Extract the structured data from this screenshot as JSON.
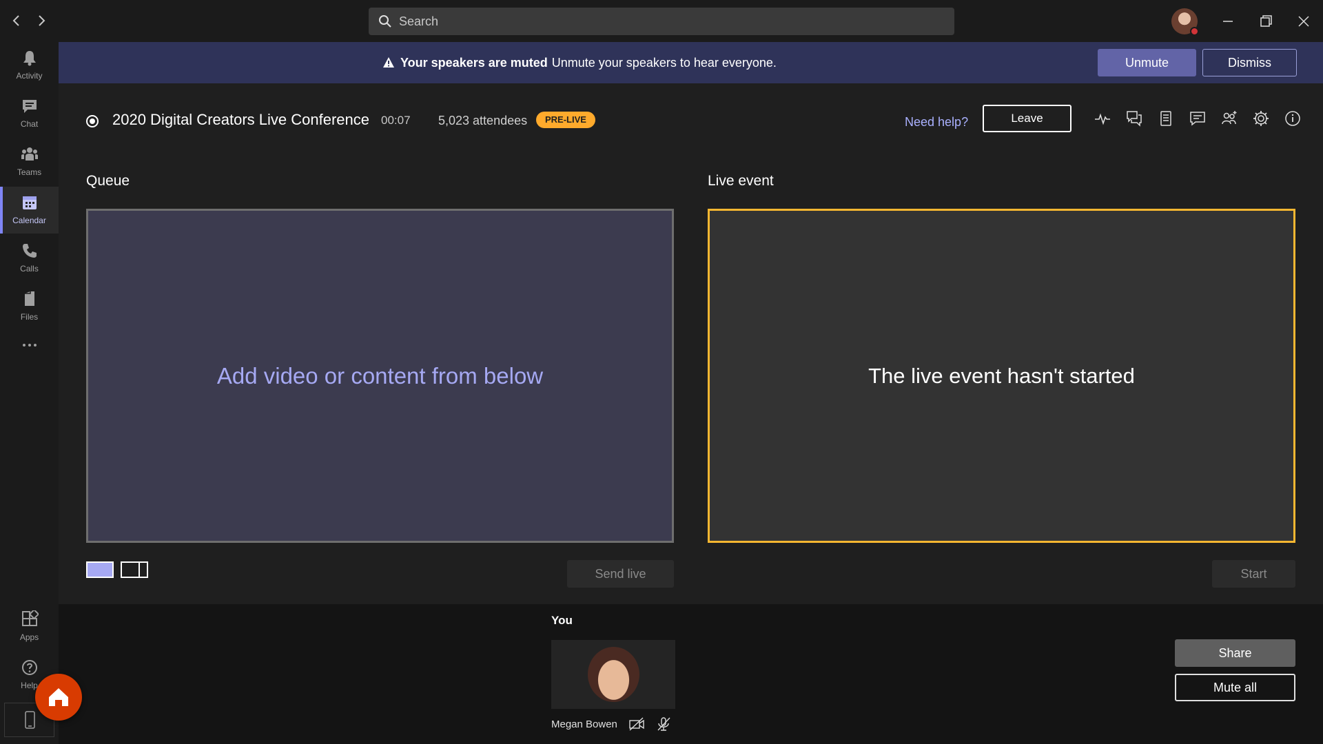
{
  "titlebar": {
    "back_icon": "chevron-left-icon",
    "forward_icon": "chevron-right-icon",
    "search_placeholder": "Search",
    "window_controls": [
      "minimize-icon",
      "restore-icon",
      "close-icon"
    ]
  },
  "rail": {
    "items": [
      {
        "label": "Activity",
        "icon": "bell-icon"
      },
      {
        "label": "Chat",
        "icon": "chat-icon"
      },
      {
        "label": "Teams",
        "icon": "teams-icon"
      },
      {
        "label": "Calendar",
        "icon": "calendar-icon",
        "active": true
      },
      {
        "label": "Calls",
        "icon": "phone-icon"
      },
      {
        "label": "Files",
        "icon": "file-icon"
      }
    ],
    "more_icon": "more-icon",
    "bottom_items": [
      {
        "label": "Apps",
        "icon": "apps-icon"
      },
      {
        "label": "Help",
        "icon": "help-icon"
      }
    ]
  },
  "banner": {
    "bold_text": "Your speakers are muted",
    "text": "Unmute your speakers to hear everyone.",
    "unmute_label": "Unmute",
    "dismiss_label": "Dismiss"
  },
  "event": {
    "title": "2020 Digital Creators Live Conference",
    "timer": "00:07",
    "attendees": "5,023 attendees",
    "status_badge": "PRE-LIVE",
    "need_help": "Need help?",
    "leave_label": "Leave"
  },
  "queue": {
    "label": "Queue",
    "placeholder": "Add video or content from below",
    "send_live_label": "Send live"
  },
  "live_event": {
    "label": "Live event",
    "message": "The live event hasn't started",
    "start_label": "Start"
  },
  "participants": {
    "you_label": "You",
    "name": "Megan Bowen"
  },
  "actions": {
    "share_label": "Share",
    "mute_all_label": "Mute all"
  },
  "colors": {
    "accent": "#6264a7",
    "live_border": "#f7b731",
    "prelive_badge": "#ffaa2c",
    "banner_bg": "#2f3359",
    "home_button": "#d83b01"
  }
}
